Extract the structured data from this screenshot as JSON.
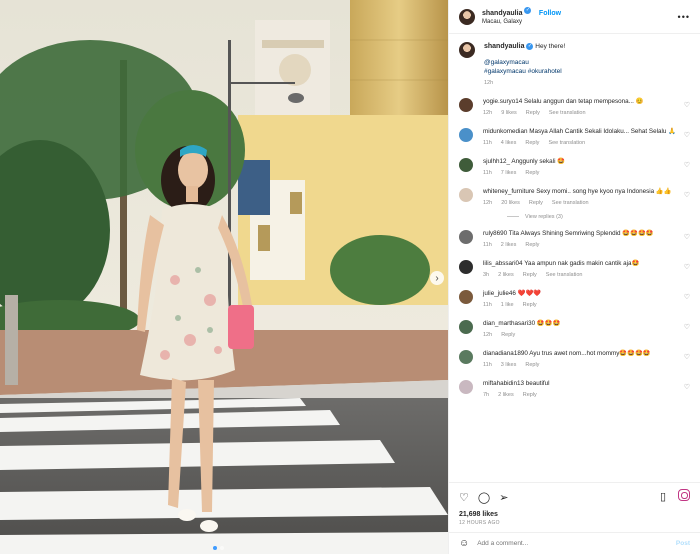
{
  "post": {
    "username": "shandyaulia",
    "follow_label": "Follow",
    "location": "Macau, Galaxy",
    "more_label": "•••",
    "caption_text": "Hey there!",
    "caption_tag1": "@galaxymacau",
    "caption_tag2": "#galaxymacau #okurahotel",
    "caption_time": "12h"
  },
  "comments": [
    {
      "user": "yogie.suryo14",
      "text": "Selalu anggun dan tetap mempesona... 😊",
      "time": "12h",
      "likes": "9 likes",
      "reply": "Reply",
      "translate": "See translation",
      "color": "#5b3d2c"
    },
    {
      "user": "midunkomedian",
      "text": "Masya Allah Cantik Sekali Idolaku... Sehat Selalu 🙏",
      "time": "11h",
      "likes": "4 likes",
      "reply": "Reply",
      "translate": "See translation",
      "color": "#4a90c9"
    },
    {
      "user": "sjulhh12_",
      "text": "Anggunly sekali 🤩",
      "time": "11h",
      "likes": "7 likes",
      "reply": "Reply",
      "translate": "",
      "color": "#3f5c3a"
    },
    {
      "user": "whiteney_furniture",
      "text": "Sexy momi.. song hye kyoo nya Indonesia 👍👍",
      "time": "12h",
      "likes": "20 likes",
      "reply": "Reply",
      "translate": "See translation",
      "color": "#d9c6b4",
      "view_replies": "View replies (3)"
    },
    {
      "user": "ruly8690",
      "text": "Tita Always Shining Semriwing Splendid 🤩🤩🤩🤩",
      "time": "11h",
      "likes": "2 likes",
      "reply": "Reply",
      "translate": "",
      "color": "#6d6d6d"
    },
    {
      "user": "lilis_abssari04",
      "text": "Yaa ampun nak gadis makin cantik aja🤩",
      "time": "3h",
      "likes": "2 likes",
      "reply": "Reply",
      "translate": "See translation",
      "color": "#2d2d2d"
    },
    {
      "user": "julie_julie46",
      "text": "❤️❤️❤️",
      "time": "11h",
      "likes": "1 like",
      "reply": "Reply",
      "translate": "",
      "color": "#7b5a3c"
    },
    {
      "user": "dian_marthasari30",
      "text": "🤩🤩🤩",
      "time": "12h",
      "likes": "",
      "reply": "Reply",
      "translate": "",
      "color": "#4b6b4f"
    },
    {
      "user": "dianadiana1890",
      "text": "Ayu trus awet nom...hot mommy🤩🤩🤩🤩",
      "time": "11h",
      "likes": "3 likes",
      "reply": "Reply",
      "translate": "",
      "color": "#5a7a5f"
    },
    {
      "user": "miftahabidin13",
      "text": "beautiful",
      "time": "7h",
      "likes": "2 likes",
      "reply": "Reply",
      "translate": "",
      "color": "#c9b8c0"
    }
  ],
  "footer": {
    "likes": "21,698 likes",
    "time": "12 HOURS AGO",
    "add_comment_placeholder": "Add a comment...",
    "post_label": "Post"
  },
  "icons": {
    "like": "heart-icon",
    "comment": "comment-icon",
    "share": "share-icon",
    "save": "bookmark-icon",
    "emoji": "emoji-icon",
    "next": "chevron-right-icon"
  },
  "colors": {
    "follow": "#0095f6",
    "verified": "#3897f0",
    "meta_gray": "#8e8e8e"
  }
}
